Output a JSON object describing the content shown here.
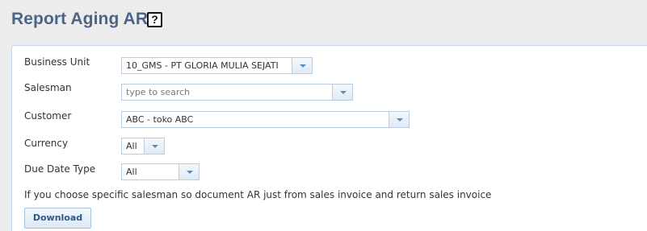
{
  "header": {
    "title": "Report Aging AR",
    "help_icon": "help-icon",
    "help_glyph": "?"
  },
  "form": {
    "business_unit": {
      "label": "Business Unit",
      "value": "10_GMS - PT GLORIA MULIA SEJATI"
    },
    "salesman": {
      "label": "Salesman",
      "value": "",
      "placeholder": "type to search"
    },
    "customer": {
      "label": "Customer",
      "value": "ABC - toko ABC"
    },
    "currency": {
      "label": "Currency",
      "value": "All"
    },
    "due_date_type": {
      "label": "Due Date Type",
      "value": "All"
    },
    "info_text": "If you choose specific salesman so document AR just from sales invoice and return sales invoice",
    "download_label": "Download"
  },
  "colors": {
    "title": "#4a6587",
    "panel_border": "#c5d7e8",
    "combo_border": "#b9cce0",
    "arrow": "#5a8bbf",
    "background": "#ececec"
  },
  "icons": {
    "dropdown": "chevron-down-icon"
  }
}
